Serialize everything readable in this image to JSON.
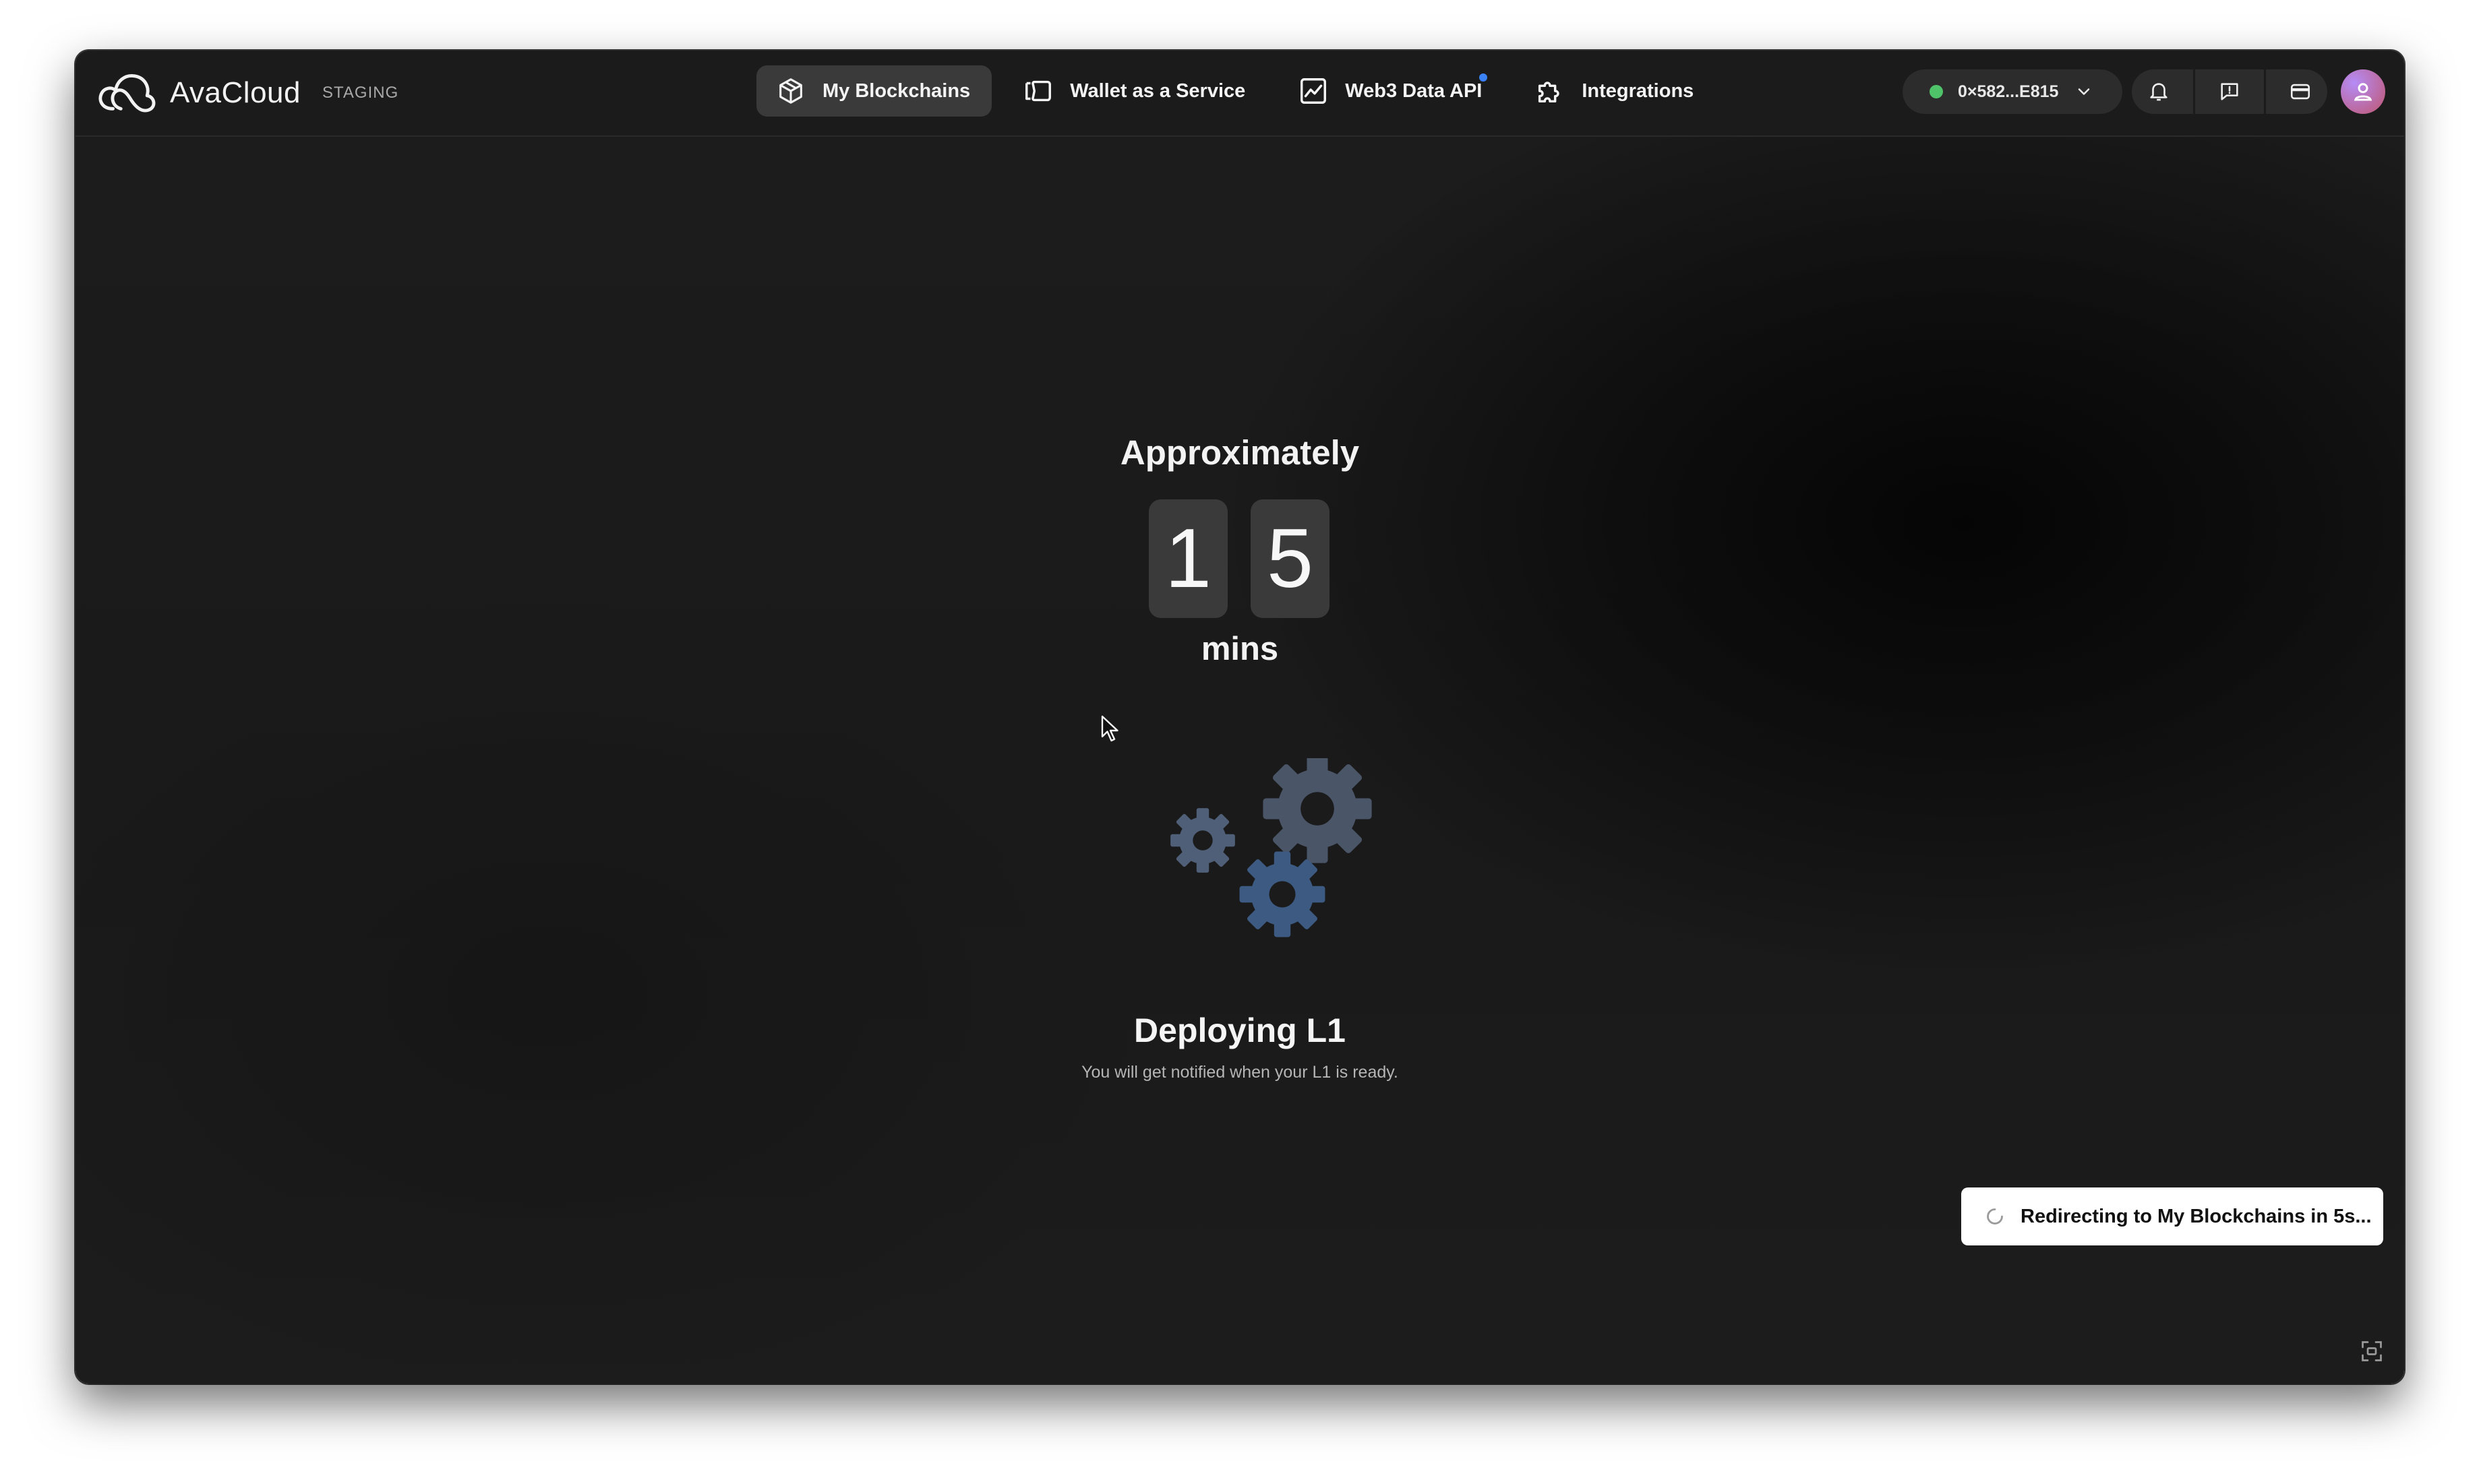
{
  "app": {
    "brand": "AvaCloud",
    "environment": "STAGING"
  },
  "nav": {
    "items": [
      {
        "label": "My Blockchains",
        "icon": "cube-icon",
        "active": true
      },
      {
        "label": "Wallet as a Service",
        "icon": "wallet-icon",
        "active": false
      },
      {
        "label": "Web3 Data API",
        "icon": "chart-icon",
        "active": false,
        "notification_dot": true
      },
      {
        "label": "Integrations",
        "icon": "puzzle-icon",
        "active": false
      }
    ]
  },
  "wallet": {
    "address": "0×582...E815",
    "status_color": "#4ec36a"
  },
  "header_actions": [
    "bell-icon",
    "feedback-icon",
    "credit-card-icon",
    "user-avatar"
  ],
  "deploy": {
    "approx_label": "Approximately",
    "digits": [
      "1",
      "5"
    ],
    "unit": "mins",
    "title": "Deploying L1",
    "subtitle": "You will get notified when your L1 is ready."
  },
  "toast": {
    "message": "Redirecting to My Blockchains in 5s..."
  },
  "colors": {
    "background": "#1b1b1b",
    "accent_dot": "#3b82f6",
    "gear_large": "#4a5568",
    "gear_blue": "#3c5a82"
  }
}
